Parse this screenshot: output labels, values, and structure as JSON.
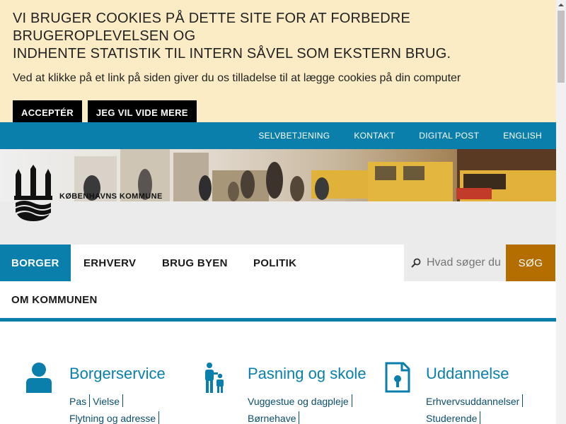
{
  "cookie": {
    "title_line1": "VI BRUGER COOKIES PÅ DETTE SITE FOR AT FORBEDRE BRUGEROPLEVELSEN OG",
    "title_line2": "INDHENTE STATISTIK TIL INTERN SÅVEL SOM EKSTERN BRUG.",
    "text": "Ved at klikke på et link på siden giver du os tilladelse til at lægge cookies på din computer",
    "accept_label": "ACCEPTÉR",
    "more_label": "JEG VIL VIDE MERE"
  },
  "topbar": {
    "links": [
      "SELVBETJENING",
      "KONTAKT",
      "DIGITAL POST",
      "ENGLISH"
    ]
  },
  "logo": {
    "text": "KØBENHAVNS KOMMUNE"
  },
  "nav": {
    "items": [
      "BORGER",
      "ERHVERV",
      "BRUG BYEN",
      "POLITIK",
      "OM KOMMUNEN"
    ],
    "active": "BORGER"
  },
  "search": {
    "placeholder": "Hvad søger du",
    "button_label": "SØG"
  },
  "sections": [
    {
      "title": "Borgerservice",
      "icon": "person-icon",
      "rows": [
        [
          "Pas",
          "Vielse"
        ],
        [
          "Flytning og adresse"
        ]
      ]
    },
    {
      "title": "Pasning og skole",
      "icon": "parent-child-icon",
      "rows": [
        [
          "Vuggestue og dagpleje"
        ],
        [
          "Børnehave"
        ]
      ]
    },
    {
      "title": "Uddannelse",
      "icon": "document-icon",
      "rows": [
        [
          "Erhvervsuddannelser"
        ],
        [
          "Studerende"
        ]
      ]
    }
  ],
  "colors": {
    "brand_blue": "#0a7fab",
    "cookie_bg": "#fbecc6",
    "search_button": "#b46e00"
  }
}
